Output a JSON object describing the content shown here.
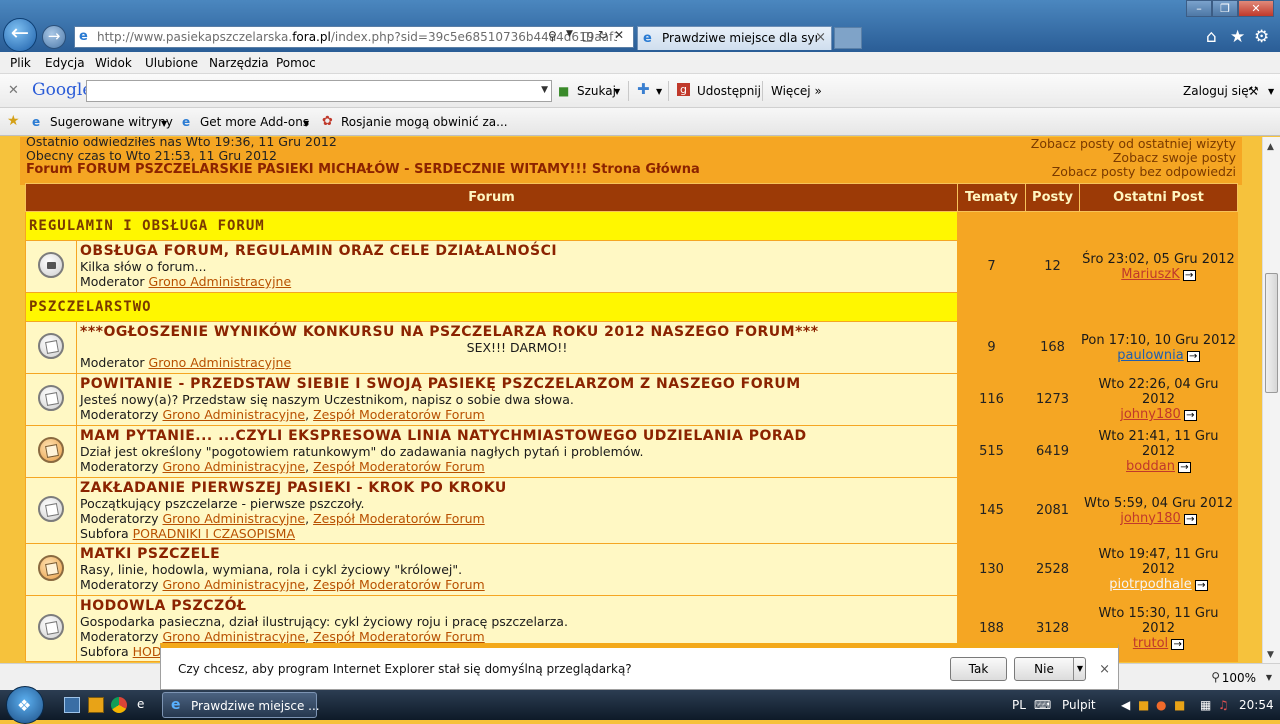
{
  "browser": {
    "url_prefix": "http://www.pasiekapszczelarska.",
    "url_domain": "fora.pl",
    "url_suffix": "/index.php?sid=39c5e68510736b44a4d619aaf3...",
    "tab_title": "Prawdziwe miejsce dla sym...",
    "tab_close": "×",
    "menu": [
      "Plik",
      "Edycja",
      "Widok",
      "Ulubione",
      "Narzędzia",
      "Pomoc"
    ]
  },
  "googlebar": {
    "logo": "Google",
    "search_placeholder": "",
    "search_label": "Szukaj",
    "share_label": "Udostępnij",
    "more_label": "Więcej »",
    "login_label": "Zaloguj się"
  },
  "favbar": {
    "items": [
      "Sugerowane witryny",
      "Get more Add-ons",
      "Rosjanie mogą obwinić za..."
    ]
  },
  "header": {
    "last_visit": "Ostatnio odwiedziłeś nas Wto 19:36, 11 Gru 2012",
    "current_time": "Obecny czas to Wto 21:53, 11 Gru 2012",
    "forum_title": "Forum FORUM PSZCZELARSKIE PASIEKI MICHAŁÓW - SERDECZNIE WITAMY!!! Strona Główna",
    "links": [
      "Zobacz posty od ostatniej wizyty",
      "Zobacz swoje posty",
      "Zobacz posty bez odpowiedzi"
    ]
  },
  "table": {
    "headers": {
      "forum": "Forum",
      "topics": "Tematy",
      "posts": "Posty",
      "last": "Ostatni Post"
    },
    "cat1": "REGULAMIN I OBSŁUGA FORUM",
    "cat2": "PSZCZELARSTWO",
    "rows": [
      {
        "name": "OBSŁUGA FORUM, REGULAMIN ORAZ CELE DZIAŁALNOŚCI",
        "desc": "Kilka słów o forum...",
        "mod_label": "Moderator",
        "mods": [
          "Grono Administracyjne"
        ],
        "topics": "7",
        "posts": "12",
        "last_time": "Śro 23:02, 05 Gru 2012",
        "last_user": "MariuszK"
      },
      {
        "name": "***OGŁOSZENIE WYNIKÓW KONKURSU NA PSZCZELARZA ROKU 2012 NASZEGO FORUM***",
        "desc": "SEX!!! DARMO!!",
        "mod_label": "Moderator",
        "mods": [
          "Grono Administracyjne"
        ],
        "topics": "9",
        "posts": "168",
        "last_time": "Pon 17:10, 10 Gru 2012",
        "last_user": "paulownia"
      },
      {
        "name": "POWITANIE - PRZEDSTAW SIEBIE I SWOJĄ PASIEKĘ PSZCZELARZOM Z NASZEGO FORUM",
        "desc": "Jesteś nowy(a)? Przedstaw się naszym Uczestnikom, napisz o sobie dwa słowa.",
        "mod_label": "Moderatorzy",
        "mods": [
          "Grono Administracyjne",
          "Zespół Moderatorów Forum"
        ],
        "topics": "116",
        "posts": "1273",
        "last_time": "Wto 22:26, 04 Gru 2012",
        "last_user": "johny180"
      },
      {
        "name": "MAM PYTANIE... ...CZYLI EKSPRESOWA LINIA NATYCHMIASTOWEGO UDZIELANIA PORAD",
        "desc": "Dział jest określony \"pogotowiem ratunkowym\" do zadawania nagłych pytań i problemów.",
        "mod_label": "Moderatorzy",
        "mods": [
          "Grono Administracyjne",
          "Zespół Moderatorów Forum"
        ],
        "topics": "515",
        "posts": "6419",
        "last_time": "Wto 21:41, 11 Gru 2012",
        "last_user": "boddan"
      },
      {
        "name": "ZAKŁADANIE PIERWSZEJ PASIEKI - KROK PO KROKU",
        "desc": "Początkujący pszczelarze - pierwsze pszczoły.",
        "mod_label": "Moderatorzy",
        "mods": [
          "Grono Administracyjne",
          "Zespół Moderatorów Forum"
        ],
        "sub_label": "Subfora",
        "sub": "PORADNIKI I CZASOPISMA",
        "topics": "145",
        "posts": "2081",
        "last_time": "Wto 5:59, 04 Gru 2012",
        "last_user": "johny180"
      },
      {
        "name": "MATKI PSZCZELE",
        "desc": "Rasy, linie, hodowla, wymiana, rola i cykl życiowy \"królowej\".",
        "mod_label": "Moderatorzy",
        "mods": [
          "Grono Administracyjne",
          "Zespół Moderatorów Forum"
        ],
        "topics": "130",
        "posts": "2528",
        "last_time": "Wto 19:47, 11 Gru 2012",
        "last_user": "piotrpodhale"
      },
      {
        "name": "HODOWLA PSZCZÓŁ",
        "desc": "Gospodarka pasieczna, dział ilustrujący: cykl życiowy roju i pracę pszczelarza.",
        "mod_label": "Moderatorzy",
        "mods": [
          "Grono Administracyjne",
          "Zespół Moderatorów Forum"
        ],
        "sub_label": "Subfora",
        "sub": "HOD",
        "topics": "188",
        "posts": "3128",
        "last_time": "Wto 15:30, 11 Gru 2012",
        "last_user": "trutol"
      }
    ]
  },
  "notification": {
    "message": "Czy chcesz, aby program Internet Explorer stał się domyślną przeglądarką?",
    "yes": "Tak",
    "no": "Nie",
    "close": "×"
  },
  "statusbar": {
    "zoom": "100%"
  },
  "taskbar": {
    "ie_window": "Prawdziwe miejsce ...",
    "lang": "PL",
    "desktop": "Pulpit",
    "clock": "20:54"
  }
}
